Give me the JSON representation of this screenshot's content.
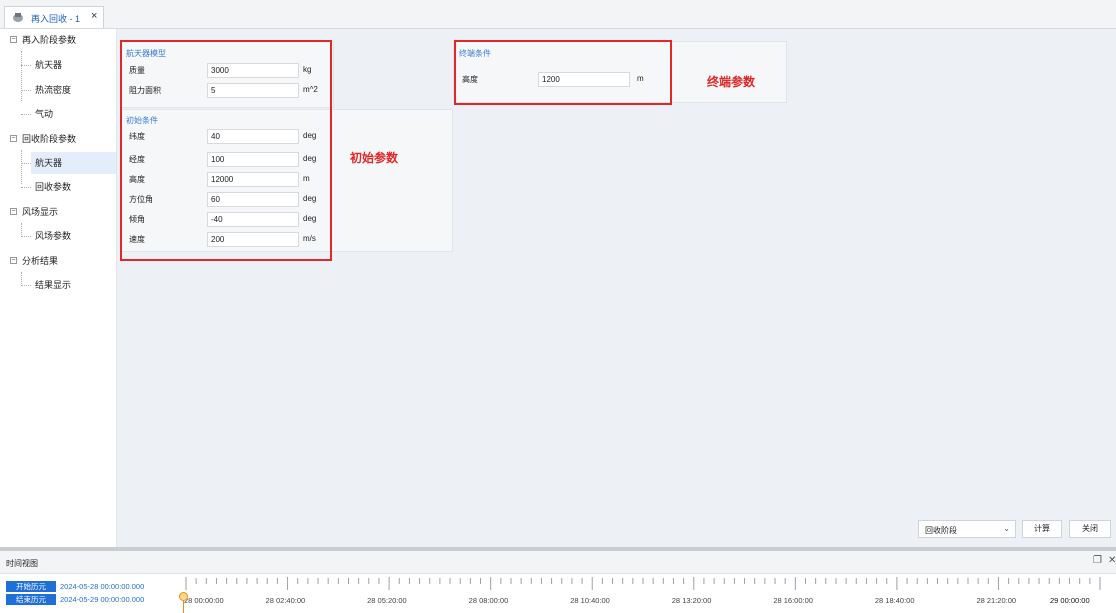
{
  "tab": {
    "label": "再入回收 - 1",
    "close": "×"
  },
  "tree": {
    "groups": [
      {
        "label": "再入阶段参数",
        "children": [
          "航天器",
          "热流密度",
          "气动"
        ]
      },
      {
        "label": "回收阶段参数",
        "children": [
          "航天器",
          "回收参数"
        ]
      },
      {
        "label": "风场显示",
        "children": [
          "风场参数"
        ]
      },
      {
        "label": "分析结果",
        "children": [
          "结果显示"
        ]
      }
    ],
    "selected": "回收阶段参数/航天器"
  },
  "model_panel": {
    "title": "航天器模型",
    "fields": [
      {
        "label": "质量",
        "value": "3000",
        "unit": "kg"
      },
      {
        "label": "阻力面积",
        "value": "5",
        "unit": "m^2"
      }
    ]
  },
  "init_panel": {
    "title": "初始条件",
    "fields": [
      {
        "label": "纬度",
        "value": "40",
        "unit": "deg"
      },
      {
        "label": "经度",
        "value": "100",
        "unit": "deg"
      },
      {
        "label": "高度",
        "value": "12000",
        "unit": "m"
      },
      {
        "label": "方位角",
        "value": "60",
        "unit": "deg"
      },
      {
        "label": "倾角",
        "value": "-40",
        "unit": "deg"
      },
      {
        "label": "速度",
        "value": "200",
        "unit": "m/s"
      }
    ]
  },
  "end_panel": {
    "title": "终端条件",
    "fields": [
      {
        "label": "高度",
        "value": "1200",
        "unit": "m"
      }
    ]
  },
  "annotations": {
    "initial": "初始参数",
    "terminal": "终端参数"
  },
  "footer": {
    "stage_select": "回收阶段",
    "compute": "计算",
    "close": "关闭"
  },
  "timeline": {
    "title": "时间视图",
    "start_label": "开始历元",
    "start_value": "2024-05-28 00:00:00.000",
    "end_label": "结束历元",
    "end_value": "2024-05-29 00:00:00.000",
    "ticks": [
      "28 00:00:00",
      "28 02:40:00",
      "28 05:20:00",
      "28 08:00:00",
      "28 10:40:00",
      "28 13:20:00",
      "28 16:00:00",
      "28 18:40:00",
      "28 21:20:00",
      "29 00:00:00"
    ]
  },
  "colors": {
    "accent": "#1f6fd6",
    "annotation_red": "#e02828",
    "marker": "#f08c16"
  }
}
